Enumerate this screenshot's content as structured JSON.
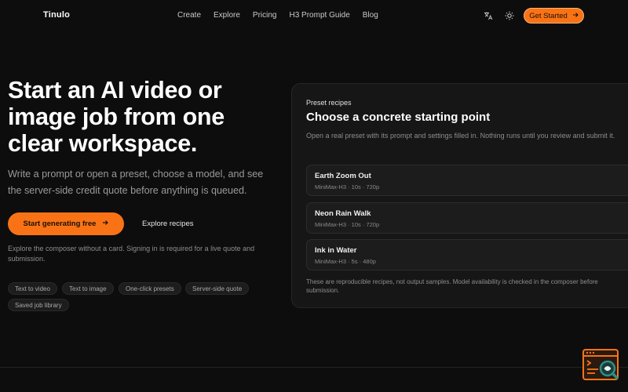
{
  "brand": {
    "name": "Tinulo"
  },
  "nav": {
    "items": [
      "Create",
      "Explore",
      "Pricing",
      "H3 Prompt Guide",
      "Blog"
    ]
  },
  "header": {
    "translate_icon": "translate-icon",
    "theme_icon": "sun-icon",
    "cta_label": "Get Started"
  },
  "hero": {
    "title": "Start an AI video or image job from one clear workspace.",
    "subtitle": "Write a prompt or open a preset, choose a model, and see the server-side credit quote before anything is queued.",
    "primary_label": "Start generating free",
    "secondary_label": "Explore recipes",
    "note": "Explore the composer without a card. Signing in is required for a live quote and submission.",
    "tags": [
      "Text to video",
      "Text to image",
      "One-click presets",
      "Server-side quote",
      "Saved job library"
    ]
  },
  "presets": {
    "eyebrow": "Preset recipes",
    "title": "Choose a concrete starting point",
    "description": "Open a real preset with its prompt and settings filled in. Nothing runs until you review and submit it.",
    "recipes": [
      {
        "name": "Earth Zoom Out",
        "meta": "MiniMax-H3 · 10s · 720p"
      },
      {
        "name": "Neon Rain Walk",
        "meta": "MiniMax-H3 · 10s · 720p"
      },
      {
        "name": "Ink in Water",
        "meta": "MiniMax-H3 · 5s · 480p"
      }
    ],
    "footnote": "These are reproducible recipes, not output samples. Model availability is checked in the composer before submission."
  },
  "colors": {
    "accent": "#f97316",
    "background": "#0d0d0d",
    "panel": "#161616"
  },
  "widget": {
    "icon": "code-review-icon"
  }
}
